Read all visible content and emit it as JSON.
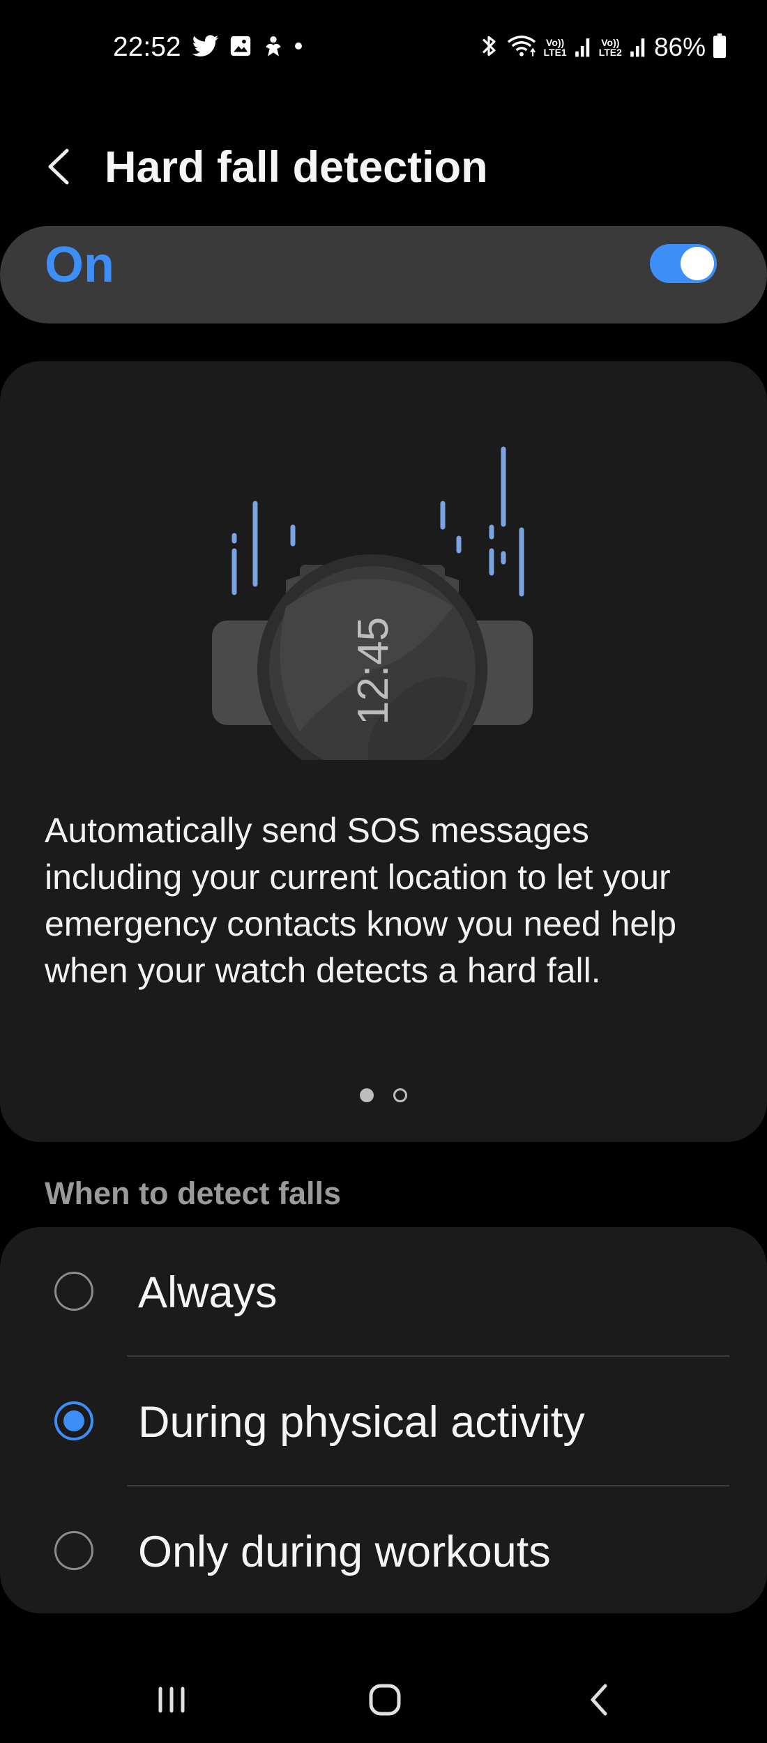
{
  "status_bar": {
    "time": "22:52",
    "left_icons": [
      "twitter-icon",
      "gallery-icon",
      "notification-icon",
      "dot-icon"
    ],
    "right_icons": [
      "bluetooth-icon",
      "wifi-icon",
      "signal-sim1-icon",
      "signal-sim2-icon",
      "battery-icon"
    ],
    "sim1_label_top": "Vo))",
    "sim1_label_bottom": "LTE1",
    "sim2_label_top": "Vo))",
    "sim2_label_bottom": "LTE2",
    "battery": "86%"
  },
  "header": {
    "title": "Hard fall detection"
  },
  "master_switch": {
    "label": "On",
    "enabled": true
  },
  "info_card": {
    "illustration_time": "12:45",
    "description": "Automatically send SOS messages including your current location to let your emergency contacts know you need help when your watch detects a hard fall.",
    "page_count": 2,
    "current_page": 1
  },
  "detect_section": {
    "header": "When to detect falls",
    "options": [
      {
        "label": "Always",
        "selected": false
      },
      {
        "label": "During physical activity",
        "selected": true
      },
      {
        "label": "Only during workouts",
        "selected": false
      }
    ]
  },
  "nav_bar": {
    "buttons": [
      "recents-icon",
      "home-icon",
      "back-icon"
    ]
  },
  "colors": {
    "accent": "#3e8ef7",
    "background": "#000000",
    "card": "#1b1b1b",
    "switch_bar": "#3a3a3a"
  }
}
